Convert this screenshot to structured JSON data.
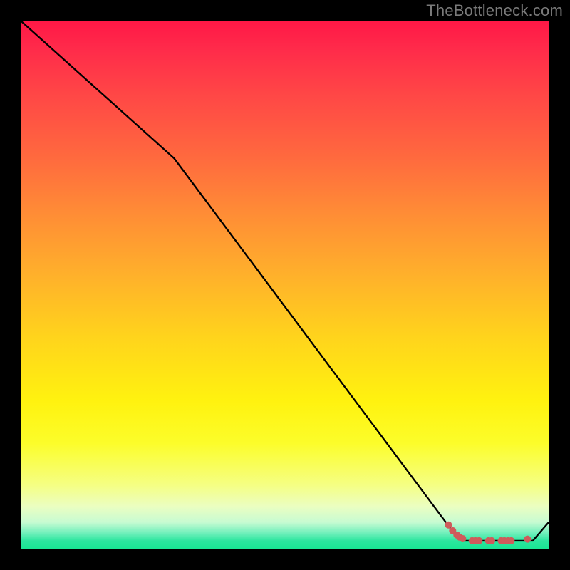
{
  "watermark": "TheBottleneck.com",
  "chart_data": {
    "type": "line",
    "title": "",
    "xlabel": "",
    "ylabel": "",
    "xlim": [
      0,
      100
    ],
    "ylim": [
      0,
      100
    ],
    "series": [
      {
        "name": "curve",
        "x": [
          0,
          29,
          82,
          84,
          97,
          100
        ],
        "y": [
          100,
          74,
          3,
          1.5,
          1.5,
          5
        ]
      }
    ],
    "markers": [
      {
        "name": "dots",
        "color": "#cf5b5b",
        "points": [
          {
            "x": 81.0,
            "y": 4.5
          },
          {
            "x": 81.8,
            "y": 3.4
          },
          {
            "x": 82.6,
            "y": 2.6
          },
          {
            "x": 83.1,
            "y": 2.2
          },
          {
            "x": 83.7,
            "y": 1.9
          },
          {
            "x": 85.5,
            "y": 1.5
          },
          {
            "x": 86.1,
            "y": 1.5
          },
          {
            "x": 86.8,
            "y": 1.5
          },
          {
            "x": 88.6,
            "y": 1.5
          },
          {
            "x": 89.2,
            "y": 1.5
          },
          {
            "x": 91.0,
            "y": 1.5
          },
          {
            "x": 91.6,
            "y": 1.5
          },
          {
            "x": 92.3,
            "y": 1.5
          },
          {
            "x": 92.9,
            "y": 1.5
          },
          {
            "x": 96.0,
            "y": 1.8
          }
        ]
      }
    ]
  }
}
